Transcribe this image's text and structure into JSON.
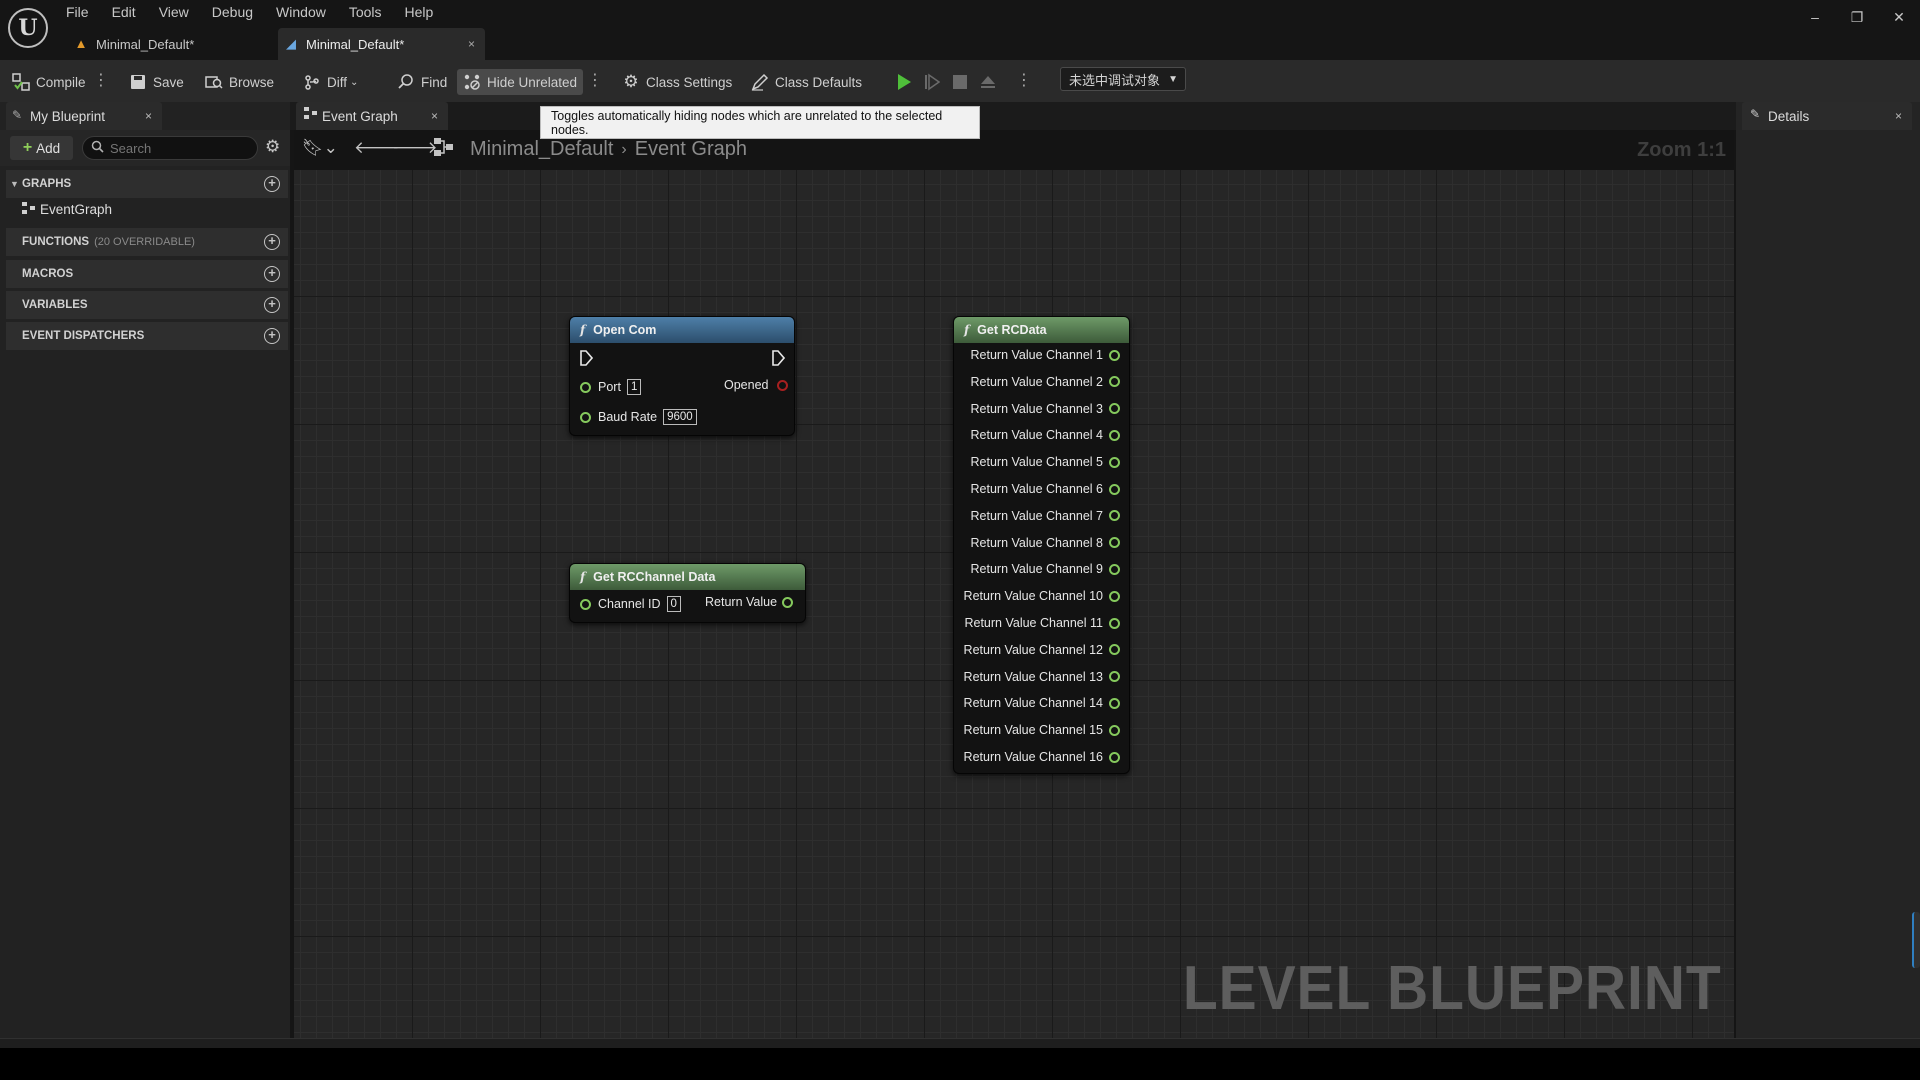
{
  "menu": [
    "File",
    "Edit",
    "View",
    "Debug",
    "Window",
    "Tools",
    "Help"
  ],
  "window_controls": {
    "minimize": "–",
    "restore": "❐",
    "close": "✕"
  },
  "doc_tabs": [
    {
      "label": "Minimal_Default*",
      "icon": "level-icon"
    },
    {
      "label": "Minimal_Default*",
      "icon": "blueprint-icon",
      "close": "×"
    }
  ],
  "toolbar": {
    "compile": "Compile",
    "save": "Save",
    "browse": "Browse",
    "diff": "Diff",
    "find": "Find",
    "hide_unrelated": "Hide Unrelated",
    "class_settings": "Class Settings",
    "class_defaults": "Class Defaults",
    "debug_object": "未选中调试对象"
  },
  "tooltip": "Toggles automatically hiding nodes which are unrelated to the selected nodes.",
  "my_blueprint": {
    "tab_label": "My Blueprint",
    "close": "×",
    "add_label": "Add",
    "search_placeholder": "Search",
    "categories": {
      "graphs": "GRAPHS",
      "graph_item": "EventGraph",
      "functions": "FUNCTIONS",
      "functions_sub": "(20 OVERRIDABLE)",
      "macros": "MACROS",
      "variables": "VARIABLES",
      "event_dispatchers": "EVENT DISPATCHERS"
    }
  },
  "graph_tab": {
    "label": "Event Graph",
    "close": "×"
  },
  "breadcrumb": {
    "root": "Minimal_Default",
    "separator": "›",
    "current": "Event Graph"
  },
  "zoom": "Zoom 1:1",
  "watermark": "LEVEL BLUEPRINT",
  "nodes": {
    "open_com": {
      "title": "Open Com",
      "port_label": "Port",
      "port_value": "1",
      "baud_label": "Baud Rate",
      "baud_value": "9600",
      "opened_label": "Opened"
    },
    "get_rcchannel": {
      "title": "Get RCChannel Data",
      "channel_label": "Channel ID",
      "channel_value": "0",
      "return_label": "Return Value"
    },
    "get_rcdata": {
      "title": "Get RCData",
      "outputs": [
        "Return Value Channel 1",
        "Return Value Channel 2",
        "Return Value Channel 3",
        "Return Value Channel 4",
        "Return Value Channel 5",
        "Return Value Channel 6",
        "Return Value Channel 7",
        "Return Value Channel 8",
        "Return Value Channel 9",
        "Return Value Channel 10",
        "Return Value Channel 11",
        "Return Value Channel 12",
        "Return Value Channel 13",
        "Return Value Channel 14",
        "Return Value Channel 15",
        "Return Value Channel 16"
      ]
    }
  },
  "details": {
    "tab_label": "Details",
    "close": "×"
  },
  "colors": {
    "func_header_blue": "#2c4e6c",
    "pure_header_green": "#3d5b3a",
    "pin_green": "#85c95d",
    "pin_red": "#a82020",
    "play_green": "#4fbf3a"
  }
}
